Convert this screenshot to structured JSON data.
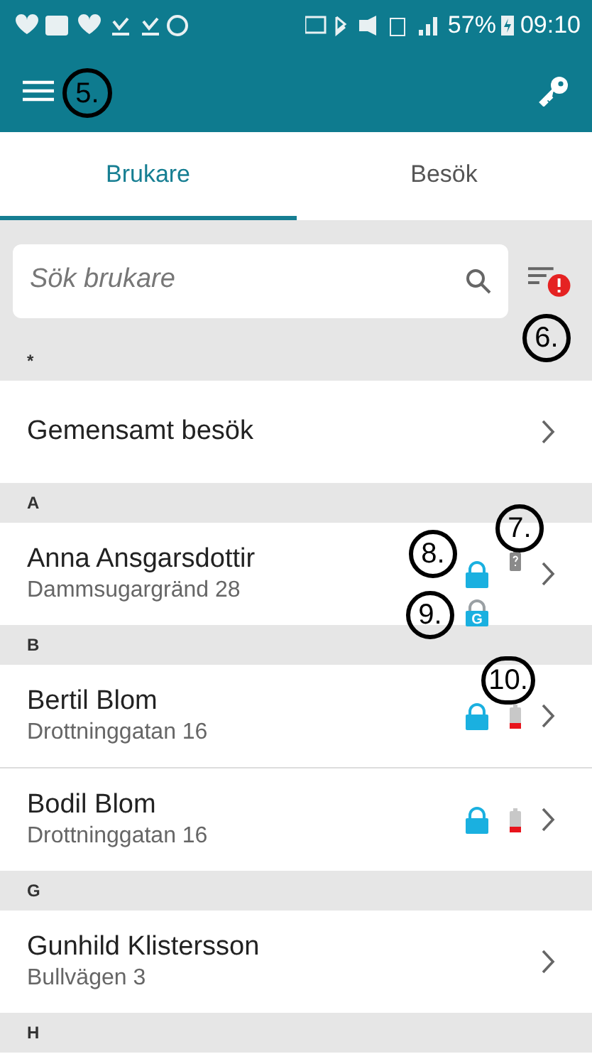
{
  "status_bar": {
    "battery": "57%",
    "time": "09:10"
  },
  "toolbar": {
    "callout": "5."
  },
  "tabs": [
    {
      "label": "Brukare",
      "selected": true
    },
    {
      "label": "Besök",
      "selected": false
    }
  ],
  "search": {
    "placeholder": "Sök brukare",
    "filter_alert": true,
    "callout": "6."
  },
  "sections": [
    {
      "header": "*",
      "rows": [
        {
          "name": "Gemensamt besök"
        }
      ]
    },
    {
      "header": "A",
      "rows": [
        {
          "name": "Anna Ansgarsdottir",
          "address": "Dammsugargränd 28",
          "lock": true,
          "battery": {
            "kind": "unknown"
          },
          "guest_lock": "G",
          "lock_callout": "8.",
          "battery_callout": "7.",
          "guest_callout": "9."
        }
      ]
    },
    {
      "header": "B",
      "rows": [
        {
          "name": "Bertil Blom",
          "address": "Drottninggatan 16",
          "lock": true,
          "battery": {
            "kind": "low"
          },
          "battery_callout": "10."
        },
        {
          "name": "Bodil Blom",
          "address": "Drottninggatan 16",
          "lock": true,
          "battery": {
            "kind": "low"
          }
        }
      ]
    },
    {
      "header": "G",
      "rows": [
        {
          "name": "Gunhild Klistersson",
          "address": "Bullvägen 3"
        }
      ]
    },
    {
      "header": "H"
    }
  ]
}
